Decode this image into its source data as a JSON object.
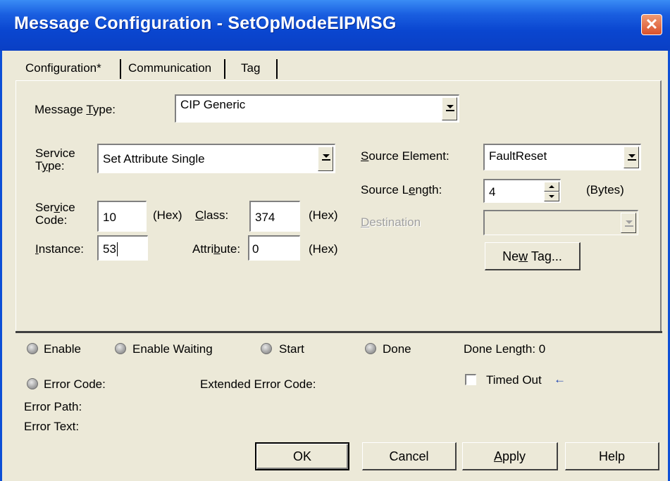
{
  "window": {
    "title": "Message Configuration - SetOpModeEIPMSG",
    "close_glyph": "✕"
  },
  "tabs": [
    {
      "label": "Configuration*",
      "selected": true
    },
    {
      "label": "Communication",
      "selected": false
    },
    {
      "label": "Tag",
      "selected": false
    }
  ],
  "config": {
    "message_type": {
      "label_pre": "Message ",
      "label_ul": "T",
      "label_post": "ype:",
      "value": "CIP Generic"
    },
    "service_type": {
      "label1": "Service",
      "label2_pre": "T",
      "label2_ul": "y",
      "label2_post": "pe:",
      "value": "Set Attribute Single"
    },
    "service_code": {
      "label1_pre": "Ser",
      "label1_ul": "v",
      "label1_post": "ice",
      "label2": "Code:",
      "value": "10",
      "unit": "(Hex)"
    },
    "class": {
      "label_pre": "",
      "label_ul": "C",
      "label_post": "lass:",
      "value": "374",
      "unit": "(Hex)"
    },
    "instance": {
      "label_pre": "",
      "label_ul": "I",
      "label_post": "nstance:",
      "value": "53"
    },
    "attribute": {
      "label_pre": "Attri",
      "label_ul": "b",
      "label_post": "ute:",
      "value": "0",
      "unit": "(Hex)"
    },
    "source_element": {
      "label_pre": "",
      "label_ul": "S",
      "label_post": "ource Element:",
      "value": "FaultReset"
    },
    "source_length": {
      "label_pre": "Source L",
      "label_ul": "e",
      "label_post": "ngth:",
      "value": "4",
      "unit": "(Bytes)"
    },
    "destination": {
      "label_pre": "",
      "label_ul": "D",
      "label_post": "estination",
      "value": ""
    },
    "new_tag": {
      "label_pre": "Ne",
      "label_ul": "w",
      "label_post": " Tag..."
    }
  },
  "status": {
    "enable": "Enable",
    "enable_waiting": "Enable Waiting",
    "start": "Start",
    "done": "Done",
    "done_length": "Done Length: 0",
    "error_code": "Error Code:",
    "extended_error_code": "Extended Error Code:",
    "timed_out": "Timed Out",
    "timed_out_arrow": "←",
    "error_path": "Error Path:",
    "error_text": "Error Text:"
  },
  "buttons": {
    "ok": "OK",
    "cancel": "Cancel",
    "apply_ul": "A",
    "apply_post": "pply",
    "help": "Help"
  },
  "colors": {
    "titlebar": "#0a46d0",
    "face": "#ece9d8",
    "close": "#d9512c",
    "arrow": "#1a3fb0"
  }
}
